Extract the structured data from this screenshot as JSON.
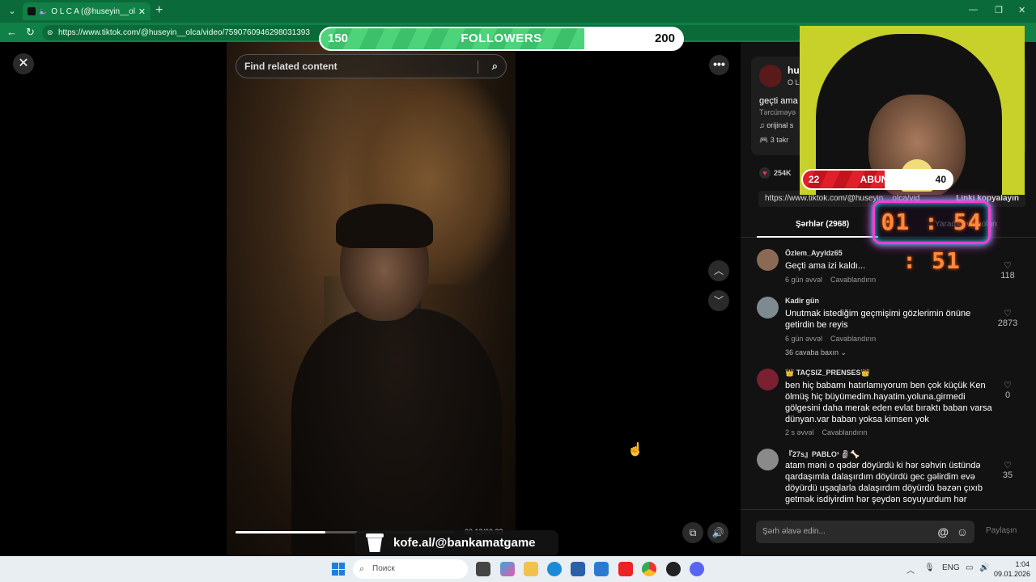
{
  "browser": {
    "tab_title": "O L C A (@huseyin__olca) | Tik",
    "url": "https://www.tiktok.com/@huseyin__olca/video/7590760946298031393"
  },
  "followers_goal": {
    "start": "150",
    "label": "FOLLOWERS",
    "end": "200",
    "progress": 0.73
  },
  "video": {
    "search_placeholder": "Find related content",
    "time": "00:13/00:33",
    "progress": 0.41
  },
  "kofe": {
    "label": "kofe.al/@bankamatgame"
  },
  "author": {
    "name": "hu",
    "sub": "O L",
    "caption": "geçti ama",
    "translate": "Tərcüməyə",
    "music": "orijinal s",
    "reactions": "3 təkr",
    "likes": "254K"
  },
  "share_link": {
    "url": "https://www.tiktok.com/@huseyin__olca/vid",
    "copy": "Linki kopyalayın"
  },
  "tabs": {
    "comments": "Şərhlər (2968)",
    "creator": "Yaradıcı videoları"
  },
  "comments": [
    {
      "user": "Özlem_Ayyldz65",
      "text": "Geçti ama izi kaldı...",
      "time": "6 gün əvvəl",
      "reply": "Cavablandırın",
      "likes": "118"
    },
    {
      "user": "Kadir gün",
      "text": "Unutmak istediğim geçmişimi gözlerimin önüne getirdin be reyis",
      "time": "6 gün əvvəl",
      "reply": "Cavablandırın",
      "likes": "2873",
      "more": "36 cavaba baxın ⌄"
    },
    {
      "user": "👑 TAÇSIZ_PRENSES👑",
      "text": "ben hiç babamı hatırlamıyorum ben çok küçük Ken ölmüş hiç büyümedim.hayatim.yoluna.girmedi gölgesini daha merak eden evlat bıraktı baban varsa dünyan.var baban yoksa kimsen yok",
      "time": "2 s əvvəl",
      "reply": "Cavablandırın",
      "likes": "0"
    },
    {
      "user": "『27s』PABLO¹ 🗿🦴",
      "text": "atam məni o qədər döyürdü ki hər səhvin üstündə qardaşımla dalaşırdım döyürdü gec gəlirdim evə döyürdü uşaqlarla dalaşırdım döyürdü bəzən çıxıb getmək isdiyirdim hər şeydən soyuyurdum hər",
      "time": "",
      "reply": "",
      "likes": "35"
    }
  ],
  "comment_input": {
    "placeholder": "Şərh əlavə edin...",
    "post": "Paylaşın"
  },
  "abune_goal": {
    "start": "22",
    "label": "ABUNE",
    "end": "40",
    "progress": 0.55
  },
  "timer": "01 : 54 : 51",
  "taskbar": {
    "search": "Поиск",
    "lang": "ENG",
    "time": "1:04",
    "date": "09.01.2026"
  }
}
